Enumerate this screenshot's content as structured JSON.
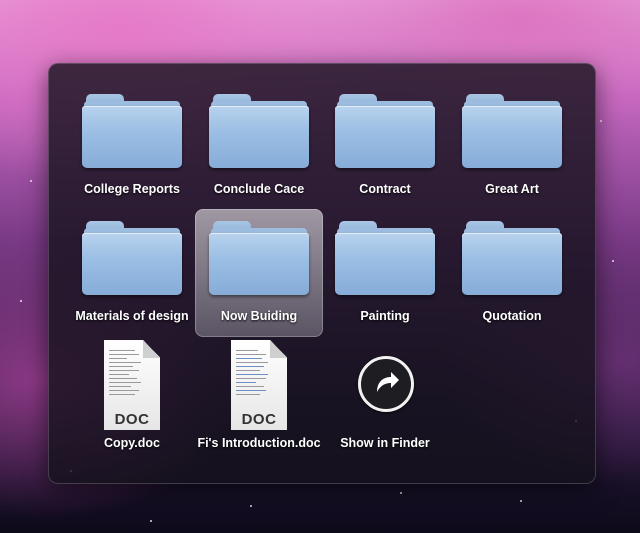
{
  "stack": {
    "items": [
      {
        "label": "College Reports",
        "type": "folder",
        "icon": "folder-icon"
      },
      {
        "label": "Conclude Cace",
        "type": "folder",
        "icon": "folder-icon"
      },
      {
        "label": "Contract",
        "type": "folder",
        "icon": "folder-icon"
      },
      {
        "label": "Great Art",
        "type": "folder",
        "icon": "folder-icon"
      },
      {
        "label": "Materials of design",
        "type": "folder",
        "icon": "folder-icon"
      },
      {
        "label": "Now Buiding",
        "type": "folder",
        "icon": "folder-icon",
        "selected": true
      },
      {
        "label": "Painting",
        "type": "folder",
        "icon": "folder-icon"
      },
      {
        "label": "Quotation",
        "type": "folder",
        "icon": "folder-icon"
      },
      {
        "label": "Copy.doc",
        "type": "document",
        "icon": "doc-file-icon",
        "ext": "DOC"
      },
      {
        "label": "Fi's Introduction.doc",
        "type": "document",
        "icon": "doc-file-icon",
        "ext": "DOC"
      }
    ],
    "show_in_finder": {
      "label": "Show in Finder",
      "icon": "arrow-curve-right-icon"
    }
  },
  "colors": {
    "folder": "#9cbfe4",
    "panel": "#14121c",
    "selection": "#c8c8d2"
  }
}
